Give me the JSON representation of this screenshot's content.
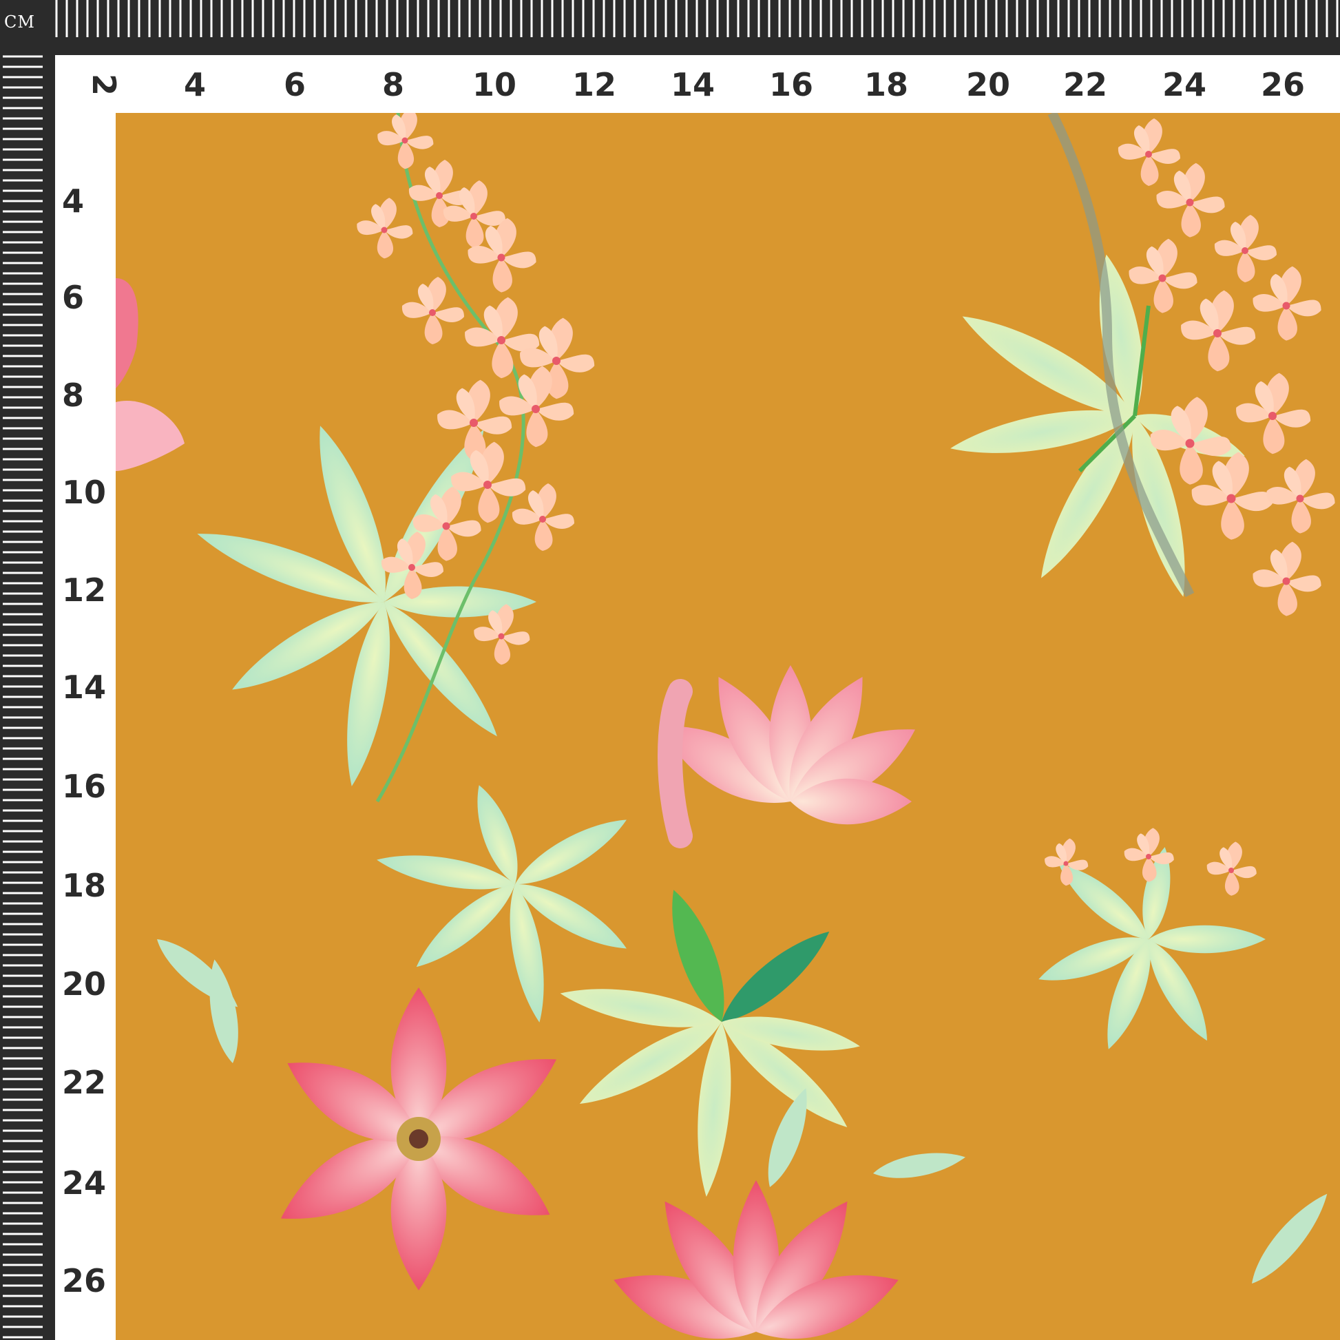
{
  "ruler": {
    "unit_label": "CM",
    "top_numbers": [
      "2",
      "4",
      "6",
      "8",
      "10",
      "12",
      "14",
      "16",
      "18",
      "20",
      "22",
      "24",
      "26"
    ],
    "left_numbers": [
      "4",
      "6",
      "8",
      "10",
      "12",
      "14",
      "16",
      "18",
      "20",
      "22",
      "24",
      "26"
    ]
  },
  "colors": {
    "ruler_bg": "#2b2b2b",
    "band_bg": "#ffffff",
    "fabric_bg": "#d9972f",
    "leaf_light": "#c9ecc4",
    "leaf_mint": "#a9e2c8",
    "leaf_yellow": "#e6f2a6",
    "leaf_green": "#5fbf5a",
    "blossom_peach": "#ffc9ae",
    "lily_pink": "#f6a7b6",
    "lily_deep": "#ee5f7a"
  }
}
